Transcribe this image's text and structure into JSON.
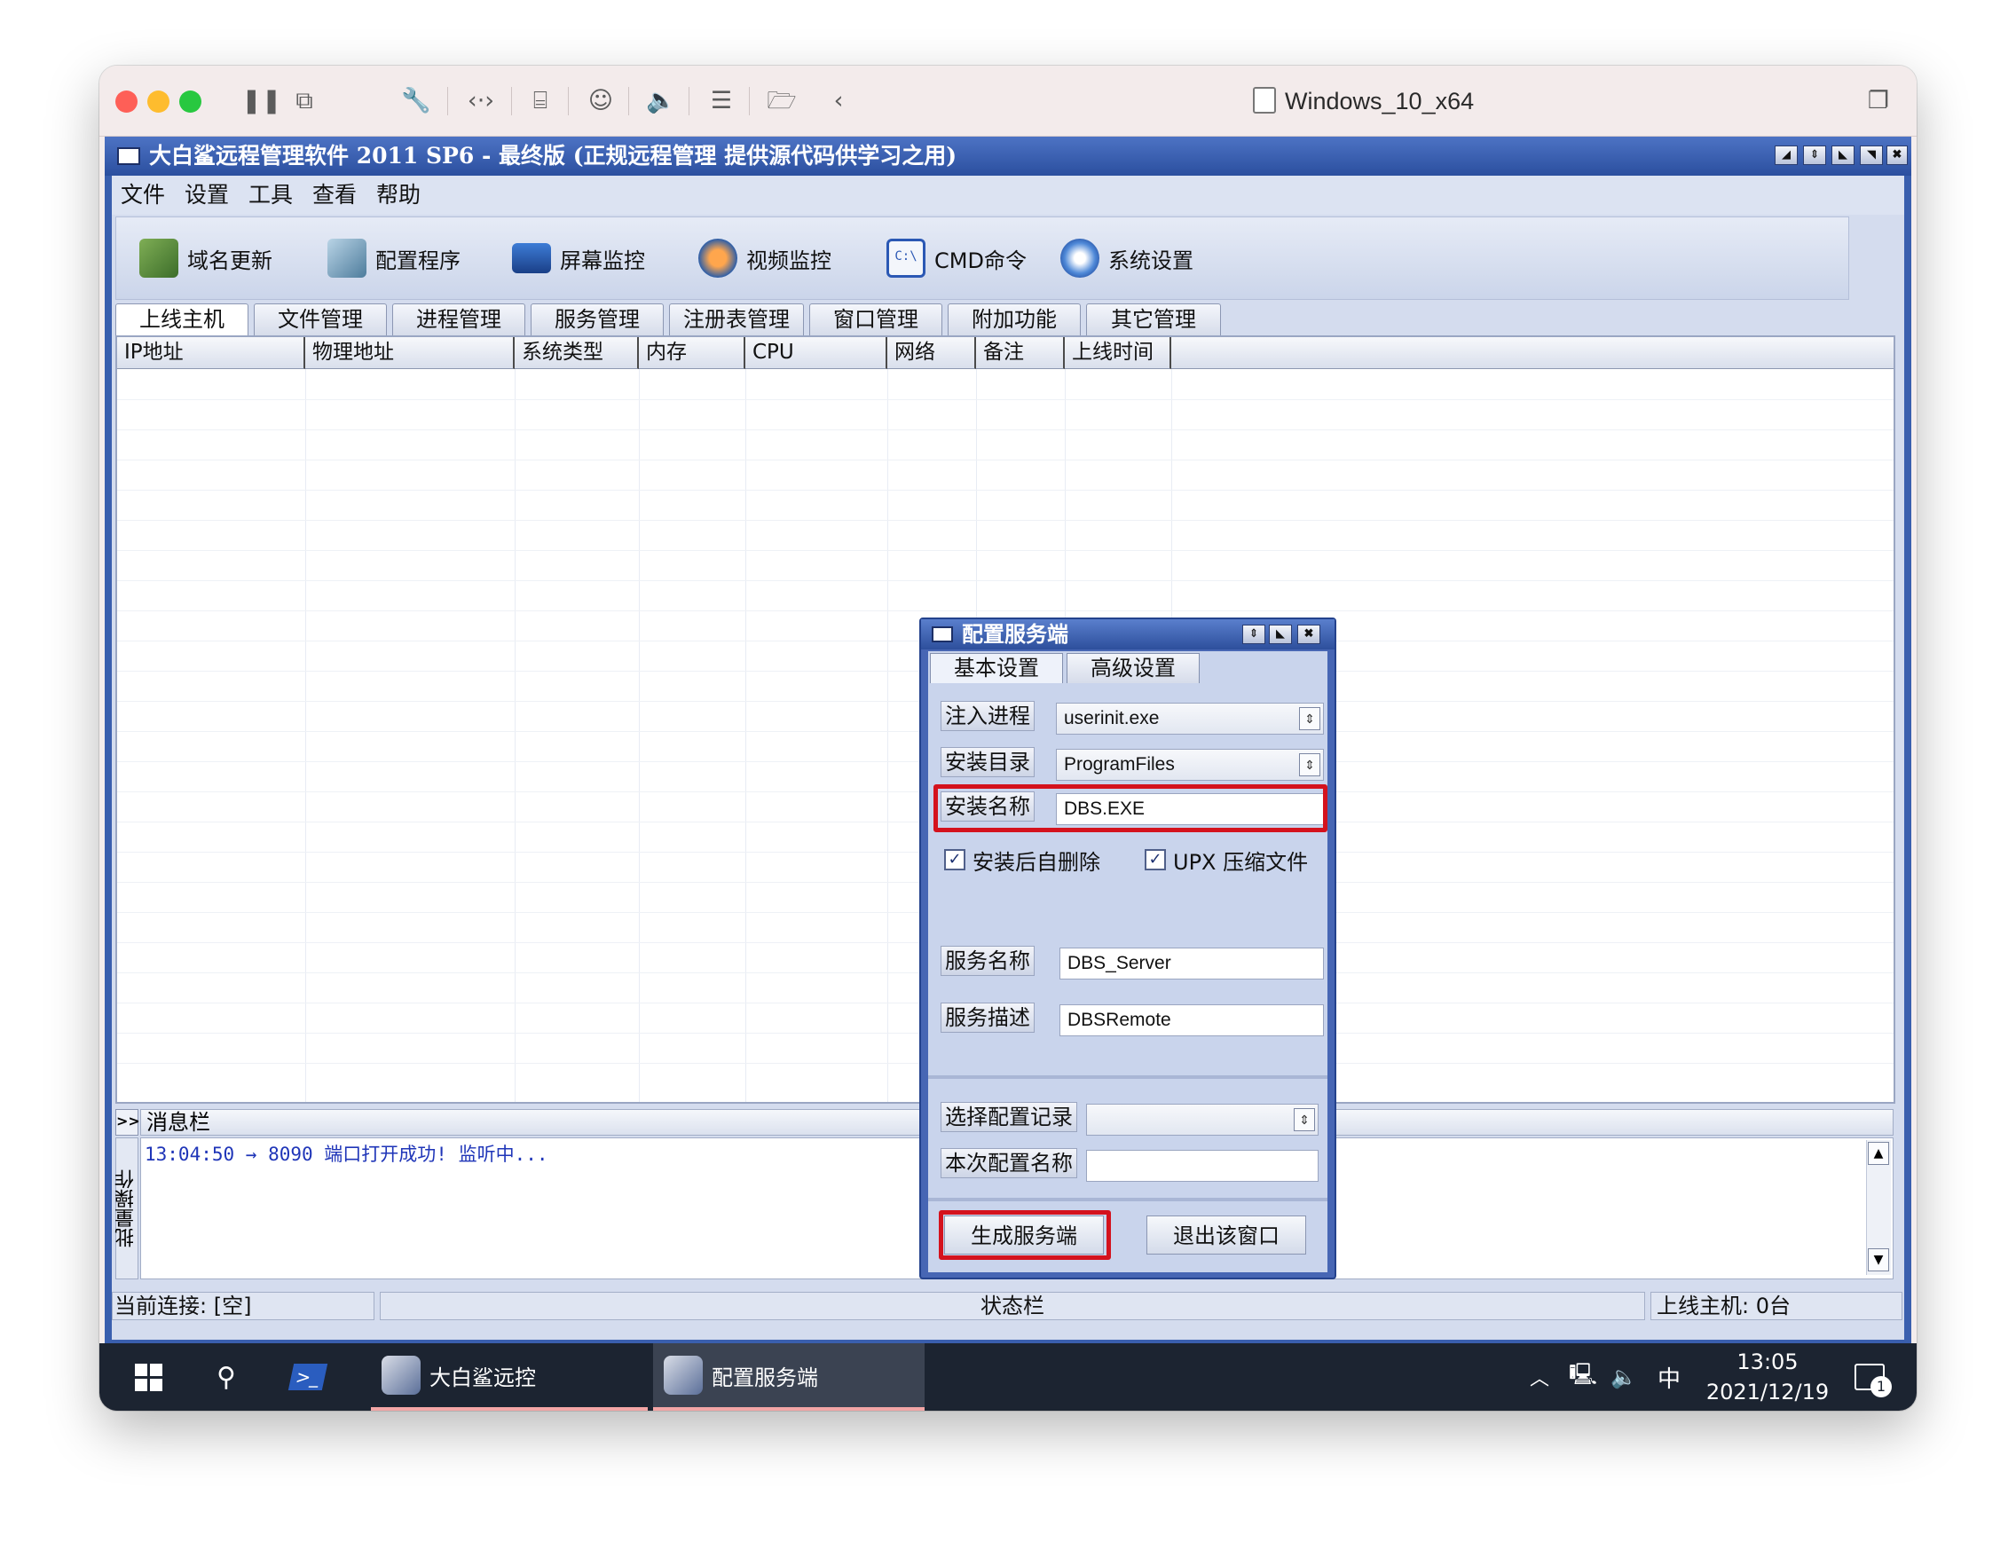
{
  "mac_window": {
    "vm_name": "Windows_10_x64",
    "colors": {
      "close": "#fe5f57",
      "minimize": "#febc2e",
      "zoom": "#28c840"
    }
  },
  "app": {
    "title": "大白鲨远程管理软件 2011 SP6 - 最终版 (正规远程管理 提供源代码供学习之用)",
    "menu": [
      "文件",
      "设置",
      "工具",
      "查看",
      "帮助"
    ],
    "toolbar": [
      {
        "label": "域名更新",
        "icon": "domain-update-icon"
      },
      {
        "label": "配置程序",
        "icon": "config-program-icon"
      },
      {
        "label": "屏幕监控",
        "icon": "screen-monitor-icon"
      },
      {
        "label": "视频监控",
        "icon": "webcam-icon"
      },
      {
        "label": "CMD命令",
        "icon": "cmd-icon"
      },
      {
        "label": "系统设置",
        "icon": "system-settings-icon"
      }
    ],
    "tabs": [
      "上线主机",
      "文件管理",
      "进程管理",
      "服务管理",
      "注册表管理",
      "窗口管理",
      "附加功能",
      "其它管理"
    ],
    "columns": [
      "IP地址",
      "物理地址",
      "系统类型",
      "内存",
      "CPU",
      "网络",
      "备注",
      "上线时间"
    ]
  },
  "dialog": {
    "title": "配置服务端",
    "tabs": [
      "基本设置",
      "高级设置"
    ],
    "inject_process": {
      "label": "注入进程",
      "value": "userinit.exe"
    },
    "install_dir": {
      "label": "安装目录",
      "value": "ProgramFiles"
    },
    "install_name": {
      "label": "安装名称",
      "value": "DBS.EXE"
    },
    "self_delete": {
      "label": "安装后自删除",
      "checked": true
    },
    "upx": {
      "label": "UPX 压缩文件",
      "checked": true
    },
    "service_name": {
      "label": "服务名称",
      "value": "DBS_Server"
    },
    "service_desc": {
      "label": "服务描述",
      "value": "DBSRemote"
    },
    "select_record": {
      "label": "选择配置记录",
      "value": ""
    },
    "config_name": {
      "label": "本次配置名称",
      "value": ""
    },
    "generate_button": "生成服务端",
    "exit_button": "退出该窗口",
    "highlight_color": "#d4121d"
  },
  "messages": {
    "header": "消息栏",
    "side_label": "批量操作",
    "expand": ">>",
    "log": "13:04:50 → 8090 端口打开成功! 监听中..."
  },
  "statusbar": {
    "connection": "当前连接: [空]",
    "center": "状态栏",
    "online": "上线主机: 0台"
  },
  "taskbar": {
    "apps": [
      {
        "label": "大白鲨远控"
      },
      {
        "label": "配置服务端"
      }
    ],
    "ime": "中",
    "time": "13:05",
    "date": "2021/12/19",
    "notifications": "1"
  }
}
